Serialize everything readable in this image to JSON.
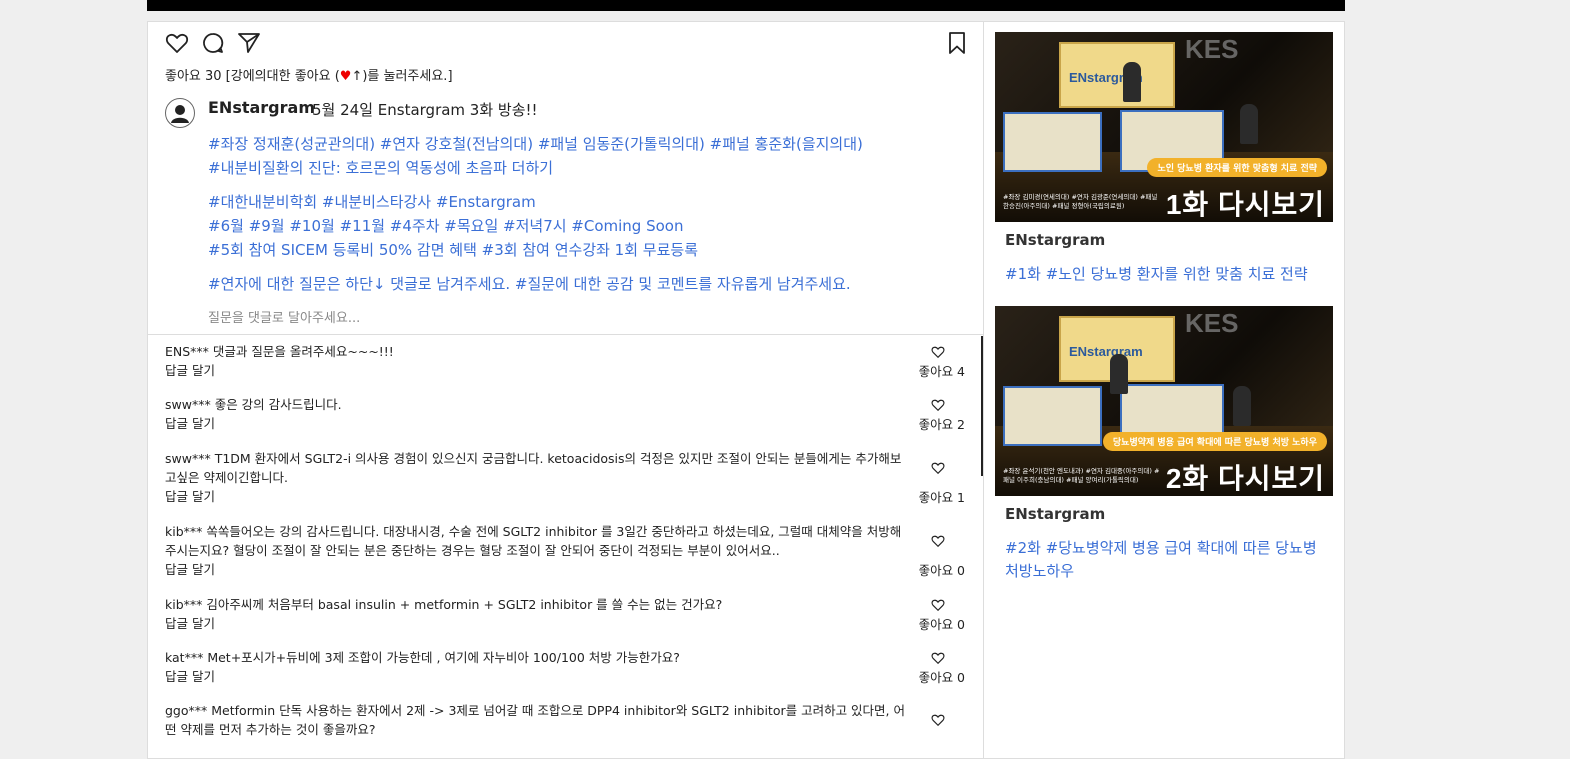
{
  "post": {
    "likes_text": "좋아요 30 [강에의대한 좋아요 (",
    "likes_heart": "♥",
    "likes_arrow": "↑",
    "likes_suffix": ")를 눌러주세요.]",
    "author": "ENstargram",
    "title": "5월 24일 Enstargram 3화 방송!!",
    "tag_lines": [
      "#좌장 정재훈(성균관의대) #연자 강호철(전남의대) #패널 임동준(가톨릭의대) #패널 홍준화(을지의대)",
      "#내분비질환의 진단: 호르몬의 역동성에 초음파 더하기",
      "#대한내분비학회 #내분비스타강사 #Enstargram",
      "#6월 #9월 #10월 #11월 #4주차 #목요일 #저녁7시 #Coming Soon",
      "#5회 참여 SICEM 등록비 50% 감면 혜택 #3회 참여 연수강좌 1회 무료등록",
      "#연자에 대한 질문은 하단↓ 댓글로 남겨주세요. #질문에 대한 공감 및 코멘트를 자유롭게 남겨주세요."
    ],
    "comment_placeholder": "질문을 댓글로 달아주세요..."
  },
  "comments": [
    {
      "user": "ENS***",
      "text": "댓글과 질문을 올려주세요~~~!!!",
      "reply": "답글 달기",
      "likes": "좋아요 4"
    },
    {
      "user": "sww***",
      "text": "좋은 강의 감사드립니다.",
      "reply": "답글 달기",
      "likes": "좋아요 2"
    },
    {
      "user": "sww***",
      "text": "T1DM 환자에서 SGLT2-i 의사용 경험이 있으신지 궁금합니다. ketoacidosis의 걱정은 있지만 조절이 안되는 분들에게는 추가해보고싶은 약제이긴합니다.",
      "reply": "답글 달기",
      "likes": "좋아요 1"
    },
    {
      "user": "kib***",
      "text": "쏙쏙들어오는 강의 감사드립니다. 대장내시경, 수술 전에 SGLT2 inhibitor 를 3일간 중단하라고 하셨는데요, 그럴때 대체약을 처방해주시는지요? 혈당이 조절이 잘 안되는 분은 중단하는 경우는 혈당 조절이 잘 안되어 중단이 걱정되는 부분이 있어서요..",
      "reply": "답글 달기",
      "likes": "좋아요 0"
    },
    {
      "user": "kib***",
      "text": "김아주씨께 처음부터 basal insulin + metformin + SGLT2 inhibitor 를 쓸 수는 없는 건가요?",
      "reply": "답글 달기",
      "likes": "좋아요 0"
    },
    {
      "user": "kat***",
      "text": "Met+포시가+듀비에 3제 조합이 가능한데 , 여기에 자누비아 100/100 처방 가능한가요?",
      "reply": "답글 달기",
      "likes": "좋아요 0"
    },
    {
      "user": "ggo***",
      "text": "Metformin 단독 사용하는 환자에서 2제 -> 3제로 넘어갈 때 조합으로 DPP4 inhibitor와 SGLT2 inhibitor를 고려하고 있다면, 어떤 약제를 먼저 추가하는 것이 좋을까요?",
      "reply": "",
      "likes": ""
    }
  ],
  "sidebar": {
    "videos": [
      {
        "thumb_logo": "ENstargram",
        "thumb_banner": "노인 당뇨병 환자를 위한 맞춤형 치료 전략",
        "thumb_credits": "#좌장 김미경(연세의대) #연자 김광준(연세의대) #패널 한승진(아주의대) #패널 정형아(국립의료원)",
        "thumb_episode": "1화 다시보기",
        "author": "ENstargram",
        "tags": "#1화 #노인 당뇨병 환자를 위한 맞춤 치료 전략"
      },
      {
        "thumb_logo": "ENstargram",
        "thumb_banner": "당뇨병약제 병용 급여 확대에 따른 당뇨병 처방 노하우",
        "thumb_credits": "#좌장 윤석기(천안 엔도내과) #연자 김대중(아주의대) #패널 이주희(충남의대) #패널 양여리(가톨릭의대)",
        "thumb_episode": "2화 다시보기",
        "author": "ENstargram",
        "tags": "#2화 #당뇨병약제 병용 급여 확대에 따른 당뇨병 처방노하우"
      }
    ],
    "thumb_brand": "KES"
  }
}
